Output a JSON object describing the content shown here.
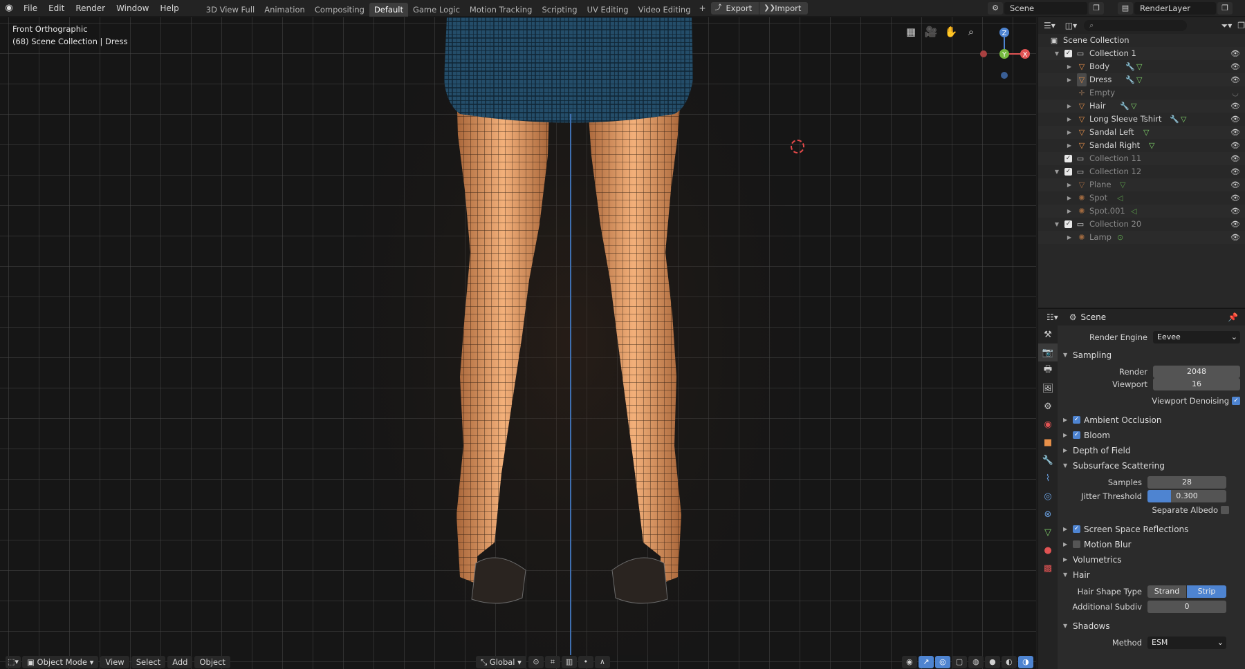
{
  "app": {
    "menu": [
      "File",
      "Edit",
      "Render",
      "Window",
      "Help"
    ],
    "workspaces": [
      "3D View Full",
      "Animation",
      "Compositing",
      "Default",
      "Game Logic",
      "Motion Tracking",
      "Scripting",
      "UV Editing",
      "Video Editing"
    ],
    "active_workspace": "Default",
    "export_label": "Export",
    "import_label": "Import",
    "scene_name": "Scene",
    "render_layer": "RenderLayer"
  },
  "viewport": {
    "view_name": "Front Orthographic",
    "context": "(68) Scene Collection | Dress",
    "gizmo": {
      "z": "Z",
      "y": "Y",
      "x": "X"
    },
    "bottom": {
      "mode": "Object Mode",
      "menus": [
        "View",
        "Select",
        "Add",
        "Object"
      ],
      "orientation": "Global"
    }
  },
  "outliner": {
    "root": "Scene Collection",
    "rows": [
      {
        "label": "Collection 1"
      },
      {
        "label": "Body"
      },
      {
        "label": "Dress"
      },
      {
        "label": "Empty"
      },
      {
        "label": "Hair"
      },
      {
        "label": "Long Sleeve Tshirt"
      },
      {
        "label": "Sandal Left"
      },
      {
        "label": "Sandal Right"
      },
      {
        "label": "Collection 11"
      },
      {
        "label": "Collection 12"
      },
      {
        "label": "Plane"
      },
      {
        "label": "Spot"
      },
      {
        "label": "Spot.001"
      },
      {
        "label": "Collection 20"
      },
      {
        "label": "Lamp"
      }
    ]
  },
  "properties": {
    "context": "Scene",
    "render_engine_label": "Render Engine",
    "render_engine": "Eevee",
    "sampling": {
      "title": "Sampling",
      "render_label": "Render",
      "render": "2048",
      "viewport_label": "Viewport",
      "viewport": "16",
      "denoise_label": "Viewport Denoising"
    },
    "ambient_occlusion": "Ambient Occlusion",
    "bloom": "Bloom",
    "depth_of_field": "Depth of Field",
    "sss": {
      "title": "Subsurface Scattering",
      "samples_label": "Samples",
      "samples": "28",
      "jitter_label": "Jitter Threshold",
      "jitter": "0.300",
      "jitter_fill": 0.3,
      "albedo_label": "Separate Albedo"
    },
    "ssr": "Screen Space Reflections",
    "motion_blur": "Motion Blur",
    "volumetrics": "Volumetrics",
    "hair": {
      "title": "Hair",
      "shape_label": "Hair Shape Type",
      "strand": "Strand",
      "strip": "Strip",
      "subdiv_label": "Additional Subdiv",
      "subdiv": "0"
    },
    "shadows": {
      "title": "Shadows",
      "method_label": "Method",
      "method": "ESM"
    }
  },
  "colors": {
    "accent": "#4e84d1",
    "mesh_orange": "#e8914a",
    "dress_blue": "#2c5a7a"
  }
}
